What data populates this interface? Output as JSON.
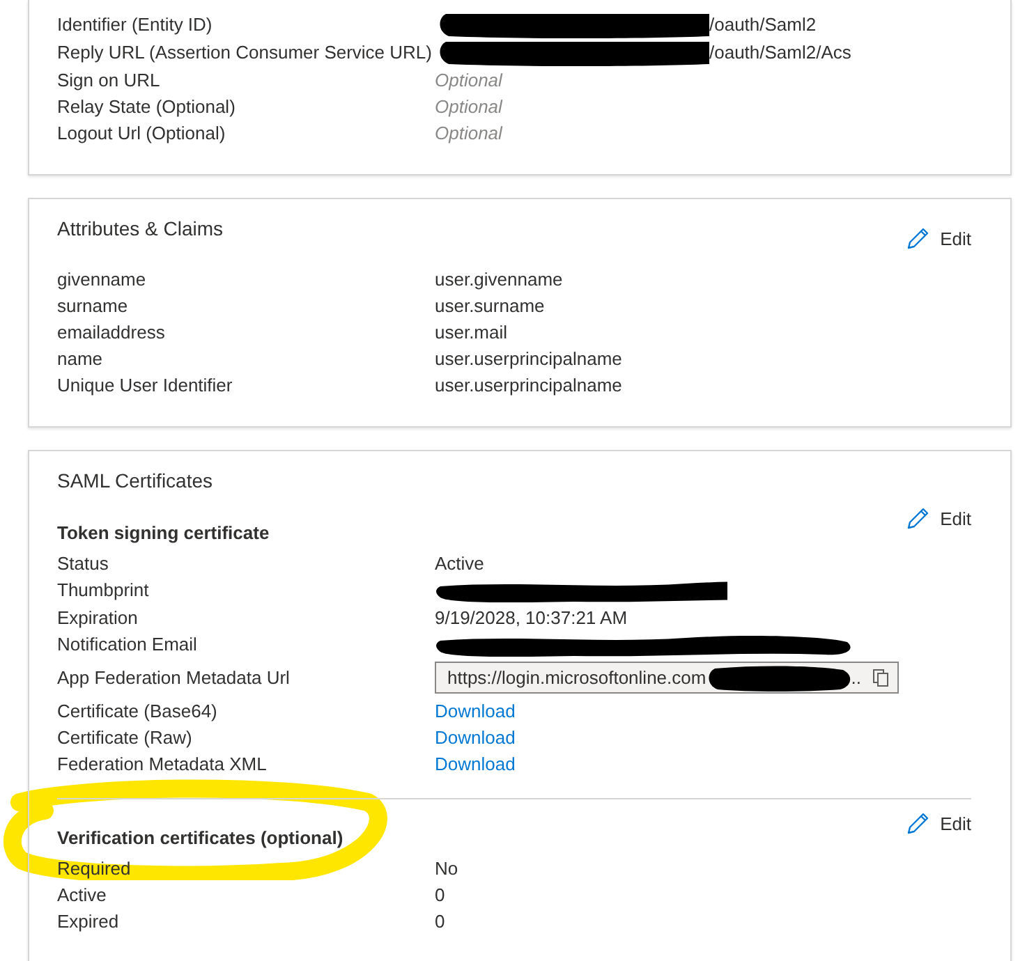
{
  "cards": [
    {
      "sections": [
        {
          "rows": [
            {
              "kind": "text",
              "label": "Identifier (Entity ID)",
              "value": "/oauth/Saml2",
              "redacted": true
            },
            {
              "kind": "text",
              "label": "Reply URL (Assertion Consumer Service URL)",
              "value": "/oauth/Saml2/Acs",
              "redacted": true
            },
            {
              "kind": "placeholder",
              "label": "Sign on URL",
              "value": "Optional"
            },
            {
              "kind": "placeholder",
              "label": "Relay State (Optional)",
              "value": "Optional"
            },
            {
              "kind": "placeholder",
              "label": "Logout Url (Optional)",
              "value": "Optional"
            }
          ]
        }
      ]
    },
    {
      "title": "Attributes & Claims",
      "sections": [
        {
          "edit": "Edit",
          "rows": [
            {
              "kind": "text",
              "label": "givenname",
              "value": "user.givenname"
            },
            {
              "kind": "text",
              "label": "surname",
              "value": "user.surname"
            },
            {
              "kind": "text",
              "label": "emailaddress",
              "value": "user.mail"
            },
            {
              "kind": "text",
              "label": "name",
              "value": "user.userprincipalname"
            },
            {
              "kind": "text",
              "label": "Unique User Identifier",
              "value": "user.userprincipalname"
            }
          ]
        }
      ]
    },
    {
      "title": "SAML Certificates",
      "sections": [
        {
          "heading": "Token signing certificate",
          "edit": "Edit",
          "rows": [
            {
              "kind": "text",
              "label": "Status",
              "value": "Active"
            },
            {
              "kind": "text",
              "label": "Thumbprint",
              "redacted": true
            },
            {
              "kind": "text",
              "label": "Expiration",
              "value": "9/19/2028, 10:37:21 AM"
            },
            {
              "kind": "text",
              "label": "Notification Email",
              "redacted": true
            },
            {
              "kind": "url_field",
              "label": "App Federation Metadata Url",
              "value": "https://login.microsoftonline.com",
              "tail": "..",
              "redacted": true
            },
            {
              "kind": "link",
              "label": "Certificate (Base64)",
              "value": "Download"
            },
            {
              "kind": "link",
              "label": "Certificate (Raw)",
              "value": "Download"
            },
            {
              "kind": "link",
              "label": "Federation Metadata XML",
              "value": "Download"
            }
          ]
        },
        {
          "heading": "Verification certificates (optional)",
          "edit": "Edit",
          "rows": [
            {
              "kind": "text",
              "label": "Required",
              "value": "No"
            },
            {
              "kind": "text",
              "label": "Active",
              "value": "0"
            },
            {
              "kind": "text",
              "label": "Expired",
              "value": "0"
            }
          ]
        }
      ]
    }
  ]
}
